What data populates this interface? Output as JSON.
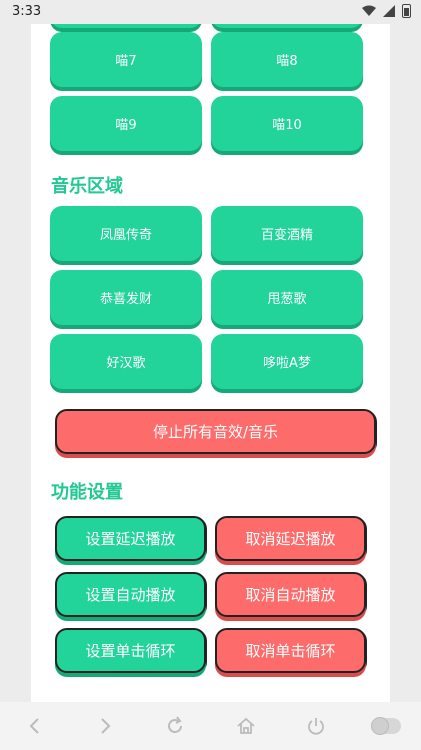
{
  "status": {
    "time": "3:33"
  },
  "sound_buttons": {
    "meow7": "喵7",
    "meow8": "喵8",
    "meow9": "喵9",
    "meow10": "喵10"
  },
  "music_section": {
    "title": "音乐区域",
    "items": [
      "凤凰传奇",
      "百变酒精",
      "恭喜发财",
      "甩葱歌",
      "好汉歌",
      "哆啦A梦"
    ]
  },
  "stop_all": "停止所有音效/音乐",
  "settings": {
    "title": "功能设置",
    "set_delay": "设置延迟播放",
    "cancel_delay": "取消延迟播放",
    "set_auto": "设置自动播放",
    "cancel_auto": "取消自动播放",
    "set_loop": "设置单击循环",
    "cancel_loop": "取消单击循环"
  },
  "colors": {
    "green": "#22d39a",
    "red": "#fe6b6b",
    "title_green": "#22c992"
  }
}
